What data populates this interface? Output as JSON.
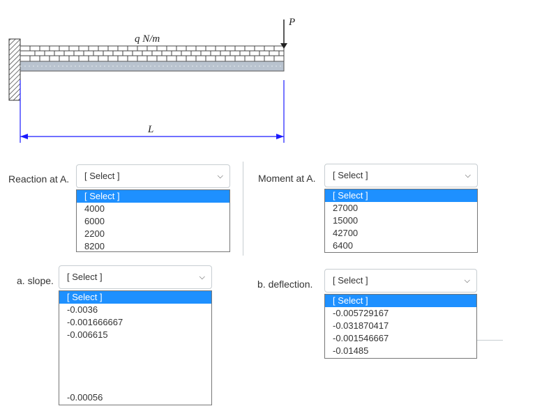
{
  "diagram": {
    "load_label": "q N/m",
    "force_label": "P",
    "length_label": "L"
  },
  "reaction": {
    "label": "Reaction at A.",
    "selected": "[ Select ]",
    "options": [
      "[ Select ]",
      "4000",
      "6000",
      "2200",
      "8200"
    ]
  },
  "moment": {
    "label": "Moment at A.",
    "selected": "[ Select ]",
    "options": [
      "[ Select ]",
      "27000",
      "15000",
      "42700",
      "6400"
    ]
  },
  "slope": {
    "label": "a. slope.",
    "selected": "[ Select ]",
    "options": [
      "[ Select ]",
      "-0.0036",
      "-0.001666667",
      "-0.006615",
      "-0.00056"
    ]
  },
  "deflection": {
    "label": "b. deflection.",
    "selected": "[ Select ]",
    "options": [
      "[ Select ]",
      "-0.005729167",
      "-0.031870417",
      "-0.001546667",
      "-0.01485"
    ]
  },
  "chevron_icon": "chevron-down-icon"
}
